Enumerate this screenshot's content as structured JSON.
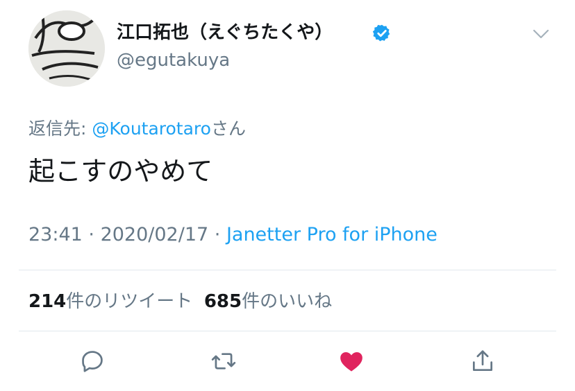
{
  "tweet": {
    "author_name": "江口拓也（えぐちたくや）",
    "handle": "@egutakuya",
    "reply_prefix": "返信先: ",
    "reply_mention": "@Koutarotaro",
    "reply_suffix": "さん",
    "text": "起こすのやめて",
    "time": "23:41",
    "separator": " · ",
    "date": "2020/02/17",
    "source": "Janetter Pro for iPhone"
  },
  "stats": {
    "retweets_count": "214",
    "retweets_label": "件のリツイート",
    "likes_count": "685",
    "likes_label": "件のいいね"
  },
  "icons": {
    "verified": "verified-badge-icon",
    "menu": "chevron-down-icon",
    "reply": "reply-icon",
    "retweet": "retweet-icon",
    "like": "heart-icon",
    "share": "share-icon"
  },
  "colors": {
    "accent": "#1da1f2",
    "like": "#e0245e",
    "muted": "#657786"
  }
}
